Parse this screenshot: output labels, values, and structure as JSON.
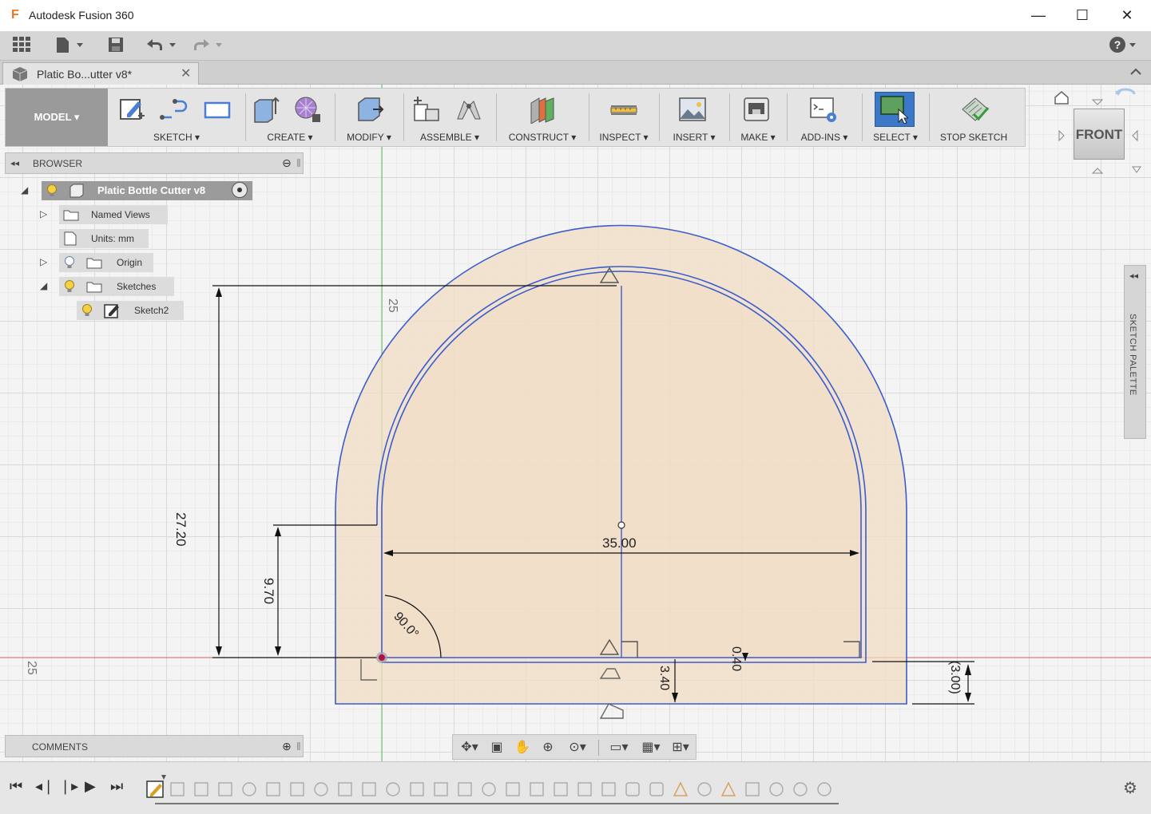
{
  "window": {
    "title": "Autodesk Fusion 360",
    "app_icon": "F",
    "minimize": "—",
    "maximize": "☐",
    "close": "✕"
  },
  "quickbar": {
    "help": "?"
  },
  "doc_tab": {
    "label": "Platic Bo...utter v8*",
    "close": "✕"
  },
  "ribbon": {
    "model": "MODEL",
    "groups": [
      {
        "label": "SKETCH"
      },
      {
        "label": "CREATE"
      },
      {
        "label": "MODIFY"
      },
      {
        "label": "ASSEMBLE"
      },
      {
        "label": "CONSTRUCT"
      },
      {
        "label": "INSPECT"
      },
      {
        "label": "INSERT"
      },
      {
        "label": "MAKE"
      },
      {
        "label": "ADD-INS"
      },
      {
        "label": "SELECT"
      },
      {
        "label": "STOP SKETCH"
      }
    ]
  },
  "browser": {
    "title": "BROWSER",
    "root": "Platic Bottle Cutter v8",
    "items": [
      "Named Views",
      "Units: mm",
      "Origin",
      "Sketches",
      "Sketch2"
    ]
  },
  "comments": {
    "title": "COMMENTS"
  },
  "palette": {
    "label": "SKETCH PALETTE"
  },
  "viewcube": {
    "face": "FRONT"
  },
  "dimensions": {
    "width": "35.00",
    "height_total": "27.20",
    "height_side": "9.70",
    "angle": "90.0°",
    "offset_small": "0.40",
    "offset_bottom": "3.40",
    "offset_ref": "(3.00)",
    "axis_top": "25",
    "axis_left": "25"
  },
  "colors": {
    "sketch_line": "#3a5ccc",
    "profile_fill": "#f2dcc4",
    "dimension": "#111111",
    "axis_x": "#e05a5a",
    "axis_y": "#59c059",
    "select_accent": "#3c78c8"
  }
}
